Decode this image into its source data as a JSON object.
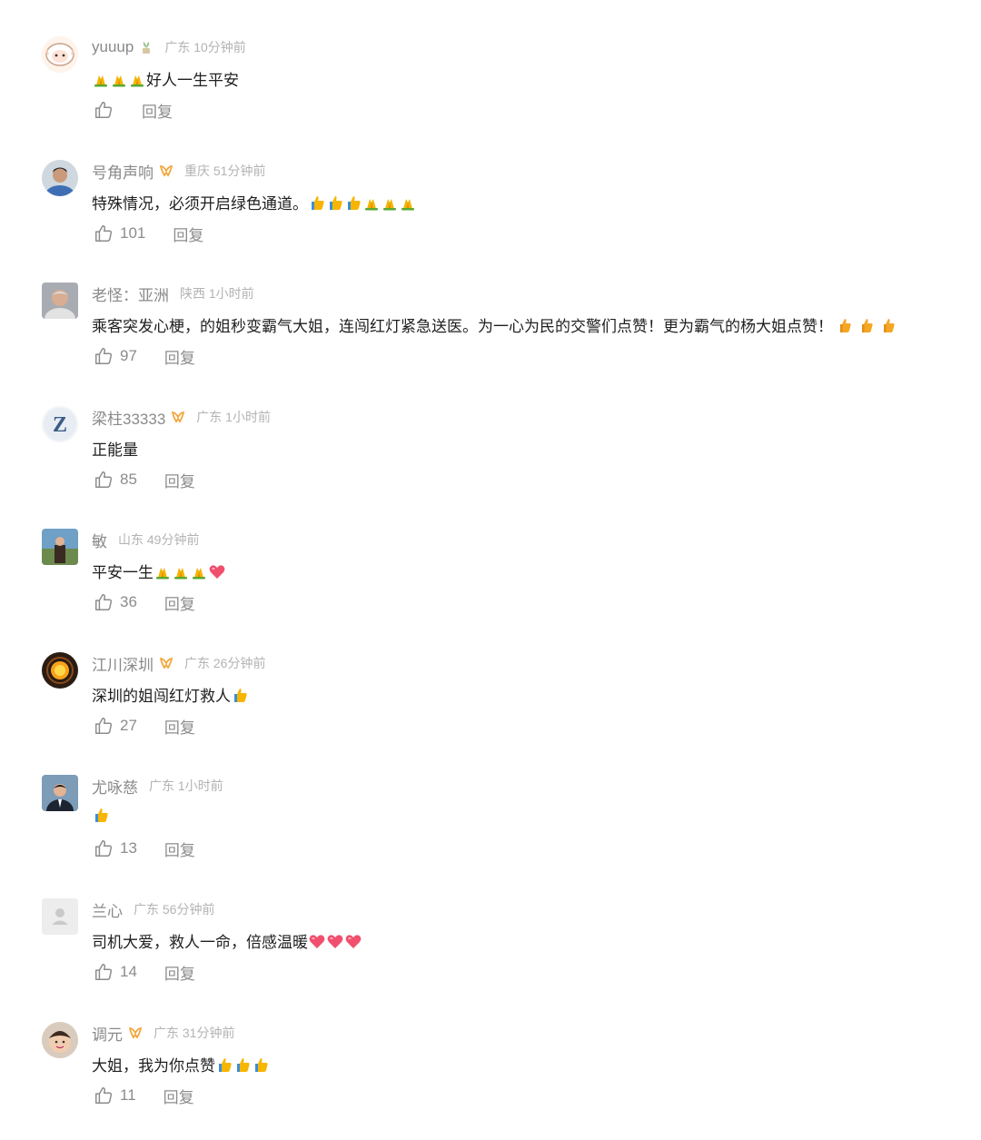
{
  "reply_label": "回复",
  "comments": [
    {
      "name": "yuuup",
      "badge": "plant",
      "location": "广东 10分钟前",
      "text": "",
      "emojis_pre": [
        "pray",
        "pray",
        "pray"
      ],
      "text_after": "好人一生平安",
      "emojis_post": [],
      "likes": "",
      "avatar": "sheep"
    },
    {
      "name": "号角声响",
      "badge": "ribbon",
      "location": "重庆 51分钟前",
      "text": "特殊情况，必须开启绿色通道。",
      "emojis_pre": [],
      "text_after": "",
      "emojis_post": [
        "thumb",
        "thumb",
        "thumb",
        "pray",
        "pray",
        "pray"
      ],
      "likes": "101",
      "avatar": "man-blue"
    },
    {
      "name": "老怪：亚洲",
      "badge": "",
      "location": "陕西 1小时前",
      "text": "乘客突发心梗，的姐秒变霸气大姐，连闯红灯紧急送医。为一心为民的交警们点赞！更为霸气的杨大姐点赞！",
      "emojis_pre": [],
      "text_after": "",
      "emojis_post": [
        "thumbsm",
        "thumbsm",
        "thumbsm"
      ],
      "likes": "97",
      "avatar": "oldman"
    },
    {
      "name": "梁柱33333",
      "badge": "ribbon",
      "location": "广东 1小时前",
      "text": "正能量",
      "emojis_pre": [],
      "text_after": "",
      "emojis_post": [],
      "likes": "85",
      "avatar": "z"
    },
    {
      "name": "敏",
      "badge": "",
      "location": "山东 49分钟前",
      "text": "平安一生",
      "emojis_pre": [],
      "text_after": "",
      "emojis_post": [
        "pray",
        "pray",
        "pray",
        "heart"
      ],
      "likes": "36",
      "avatar": "person-field"
    },
    {
      "name": "江川深圳",
      "badge": "ribbon",
      "location": "广东 26分钟前",
      "text": "深圳的姐闯红灯救人",
      "emojis_pre": [],
      "text_after": "",
      "emojis_post": [
        "thumb"
      ],
      "likes": "27",
      "avatar": "sun"
    },
    {
      "name": "尤咏慈",
      "badge": "",
      "location": "广东 1小时前",
      "text": "",
      "emojis_pre": [],
      "text_after": "",
      "emojis_post": [
        "thumb"
      ],
      "likes": "13",
      "avatar": "suit"
    },
    {
      "name": "兰心",
      "badge": "",
      "location": "广东 56分钟前",
      "text": "司机大爱，救人一命，倍感温暖",
      "emojis_pre": [],
      "text_after": "",
      "emojis_post": [
        "heart",
        "heart",
        "heart"
      ],
      "likes": "14",
      "avatar": "default"
    },
    {
      "name": "调元",
      "badge": "ribbon",
      "location": "广东 31分钟前",
      "text": "大姐，我为你点赞",
      "emojis_pre": [],
      "text_after": "",
      "emojis_post": [
        "thumb",
        "thumb",
        "thumb"
      ],
      "likes": "11",
      "avatar": "child"
    }
  ]
}
